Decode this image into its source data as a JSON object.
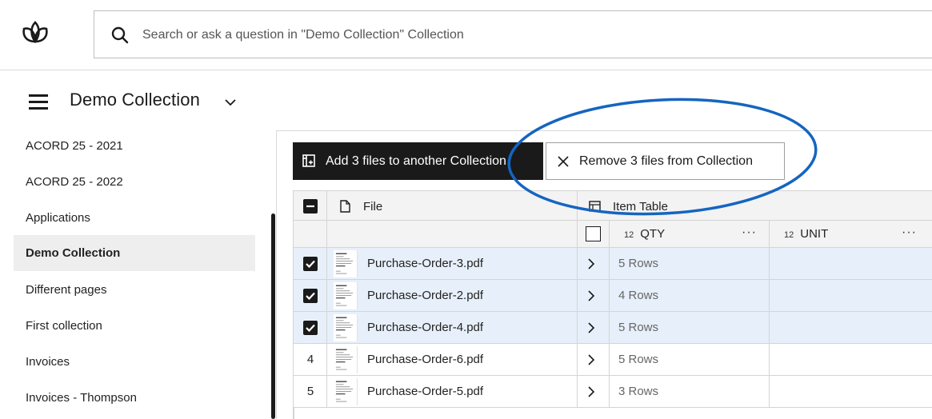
{
  "search": {
    "placeholder": "Search or ask a question in \"Demo Collection\" Collection"
  },
  "header": {
    "title": "Demo Collection"
  },
  "sidebar": {
    "items": [
      {
        "label": "ACORD 25 - 2021",
        "active": false
      },
      {
        "label": "ACORD 25 - 2022",
        "active": false
      },
      {
        "label": "Applications",
        "active": false
      },
      {
        "label": "Demo Collection",
        "active": true
      },
      {
        "label": "Different pages",
        "active": false
      },
      {
        "label": "First collection",
        "active": false
      },
      {
        "label": "Invoices",
        "active": false
      },
      {
        "label": "Invoices - Thompson",
        "active": false
      }
    ]
  },
  "actions": {
    "add_label": "Add 3 files to another Collection",
    "remove_label": "Remove 3 files from Collection"
  },
  "table": {
    "file_header": "File",
    "group_header": "Item Table",
    "columns": [
      {
        "type": "12",
        "label": "QTY",
        "menu": "···"
      },
      {
        "type": "12",
        "label": "UNIT",
        "menu": "···"
      }
    ],
    "rows": [
      {
        "selected": true,
        "index": "",
        "file": "Purchase-Order-3.pdf",
        "rows": "5 Rows"
      },
      {
        "selected": true,
        "index": "",
        "file": "Purchase-Order-2.pdf",
        "rows": "4 Rows"
      },
      {
        "selected": true,
        "index": "",
        "file": "Purchase-Order-4.pdf",
        "rows": "5 Rows"
      },
      {
        "selected": false,
        "index": "4",
        "file": "Purchase-Order-6.pdf",
        "rows": "5 Rows"
      },
      {
        "selected": false,
        "index": "5",
        "file": "Purchase-Order-5.pdf",
        "rows": "3 Rows"
      }
    ]
  },
  "colors": {
    "accent_annotation": "#1565c0",
    "selected_row": "#e7f0fa",
    "dark": "#1a1a1a"
  }
}
